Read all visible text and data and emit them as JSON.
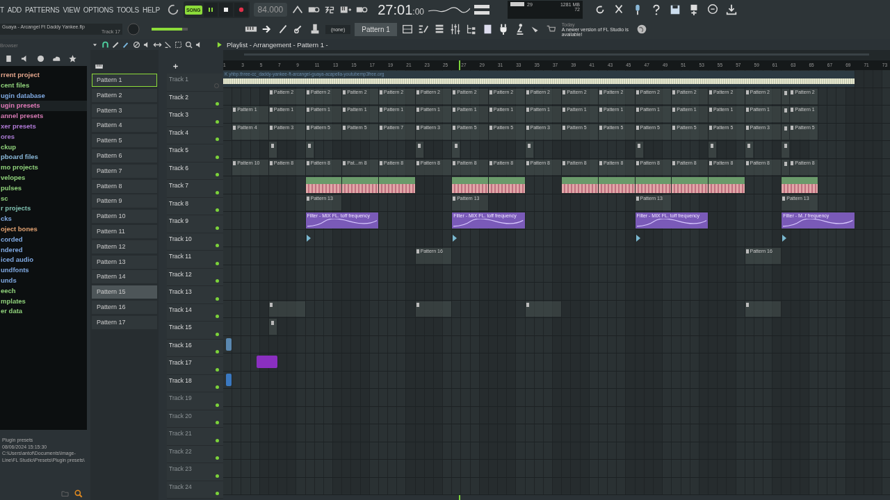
{
  "menu": [
    "T",
    "ADD",
    "PATTERNS",
    "VIEW",
    "OPTIONS",
    "TOOLS",
    "HELP"
  ],
  "transport": {
    "mode_label": "SONG",
    "song_mode": true,
    "playing": true,
    "tempo": "84.000",
    "time": "27:01",
    "time_sub": ":00"
  },
  "project": {
    "title": "Guaya - Arcangel Ft Daddy Yankee.flp",
    "hint": "Track 17"
  },
  "master_volume": {
    "level": 0.85
  },
  "monitor": {
    "cpu": "29",
    "memory": "1281 MB",
    "polyphony": "72"
  },
  "snap": {
    "value": "(none)"
  },
  "pattern_selector": {
    "value": "Pattern 1"
  },
  "news": {
    "when": "Today",
    "text": "A newer version of FL Studio is available!"
  },
  "browser": {
    "title": "Browser",
    "items": [
      {
        "label": "rrent project",
        "color": "#e0a38a",
        "selected": false
      },
      {
        "label": "cent files",
        "color": "#8fd07a",
        "selected": false
      },
      {
        "label": "ugin database",
        "color": "#7fa8e0",
        "selected": false
      },
      {
        "label": "ugin presets",
        "color": "#e07ab8",
        "selected": true
      },
      {
        "label": "annel presets",
        "color": "#d67ab4",
        "selected": false
      },
      {
        "label": "xer presets",
        "color": "#b07ad6",
        "selected": false
      },
      {
        "label": "ores",
        "color": "#a87ad0",
        "selected": false
      },
      {
        "label": "ckup",
        "color": "#8fd07a",
        "selected": false
      },
      {
        "label": "pboard files",
        "color": "#8ab8d8",
        "selected": false
      },
      {
        "label": "mo projects",
        "color": "#8fd07a",
        "selected": false
      },
      {
        "label": "velopes",
        "color": "#8fd07a",
        "selected": false
      },
      {
        "label": "pulses",
        "color": "#8fd07a",
        "selected": false
      },
      {
        "label": "sc",
        "color": "#8fd07a",
        "selected": false
      },
      {
        "label": "r projects",
        "color": "#7fc0b0",
        "selected": false
      },
      {
        "label": "cks",
        "color": "#7fa8e0",
        "selected": false
      },
      {
        "label": "oject bones",
        "color": "#e0a070",
        "selected": false
      },
      {
        "label": "corded",
        "color": "#7fa8e0",
        "selected": false
      },
      {
        "label": "ndered",
        "color": "#7fa8e0",
        "selected": false
      },
      {
        "label": "iced audio",
        "color": "#7fa8e0",
        "selected": false
      },
      {
        "label": "undfonts",
        "color": "#7fa8e0",
        "selected": false
      },
      {
        "label": "unds",
        "color": "#7fa8e0",
        "selected": false
      },
      {
        "label": "eech",
        "color": "#8fd07a",
        "selected": false
      },
      {
        "label": "mplates",
        "color": "#8fd07a",
        "selected": false
      },
      {
        "label": "er data",
        "color": "#8fd07a",
        "selected": false
      }
    ],
    "info": [
      "Plugin presets",
      "08/06/2024 15:15:30",
      "C:\\Users\\antof\\Documents\\Image-Line\\FL Studio\\Presets\\Plugin presets\\"
    ]
  },
  "playlist": {
    "title": "Playlist - Arrangement - Pattern 1 -",
    "ruler": [
      "1",
      "3",
      "5",
      "7",
      "9",
      "11",
      "13",
      "15",
      "17",
      "19",
      "21",
      "23",
      "25",
      "27",
      "29",
      "31",
      "33",
      "35",
      "37",
      "39",
      "41",
      "43",
      "45",
      "47",
      "49",
      "51",
      "53",
      "55",
      "57",
      "59",
      "61",
      "63",
      "65",
      "67",
      "69",
      "71",
      "73"
    ],
    "playhead": {
      "level": 0.353
    },
    "patterns": [
      {
        "label": "Pattern 1",
        "selected": true,
        "hover": false
      },
      {
        "label": "Pattern 2",
        "selected": false,
        "hover": false
      },
      {
        "label": "Pattern 3",
        "selected": false,
        "hover": false
      },
      {
        "label": "Pattern 4",
        "selected": false,
        "hover": false
      },
      {
        "label": "Pattern 5",
        "selected": false,
        "hover": false
      },
      {
        "label": "Pattern 6",
        "selected": false,
        "hover": false
      },
      {
        "label": "Pattern 7",
        "selected": false,
        "hover": false
      },
      {
        "label": "Pattern 8",
        "selected": false,
        "hover": false
      },
      {
        "label": "Pattern 9",
        "selected": false,
        "hover": false
      },
      {
        "label": "Pattern 10",
        "selected": false,
        "hover": false
      },
      {
        "label": "Pattern 11",
        "selected": false,
        "hover": false
      },
      {
        "label": "Pattern 12",
        "selected": false,
        "hover": false
      },
      {
        "label": "Pattern 13",
        "selected": false,
        "hover": false
      },
      {
        "label": "Pattern 14",
        "selected": false,
        "hover": false
      },
      {
        "label": "Pattern 15",
        "selected": false,
        "hover": true
      },
      {
        "label": "Pattern 16",
        "selected": false,
        "hover": false
      },
      {
        "label": "Pattern 17",
        "selected": false,
        "hover": false
      }
    ],
    "tracks": [
      {
        "name": "Track 1",
        "dim": true,
        "led_on": false,
        "clips": [
          {
            "kind": "audio",
            "label": "K yhbp.three-cc_daddy-yankee-ft-arcangel-guaya-acapella-youtubemp3free.org"
          }
        ]
      },
      {
        "name": "Track 2",
        "dim": false,
        "led_on": true,
        "clips": [
          {
            "kind": "empty"
          },
          {
            "kind": "empty"
          },
          {
            "kind": "pattern",
            "label": "Pattern 2"
          },
          {
            "kind": "pattern",
            "label": "Pattern 2"
          },
          {
            "kind": "pattern",
            "label": "Pattern 2"
          },
          {
            "kind": "pattern",
            "label": "Pattern 2"
          },
          {
            "kind": "pattern",
            "label": "Pattern 2"
          },
          {
            "kind": "pattern",
            "label": "Pattern 2"
          },
          {
            "kind": "pattern",
            "label": "Pattern 2"
          },
          {
            "kind": "pattern",
            "label": "Pattern 2"
          },
          {
            "kind": "pattern",
            "label": "Pattern 2"
          },
          {
            "kind": "pattern",
            "label": "Pattern 2"
          },
          {
            "kind": "pattern",
            "label": "Pattern 2"
          },
          {
            "kind": "pattern",
            "label": "Pattern 2"
          },
          {
            "kind": "pattern",
            "label": "Pattern 2"
          },
          {
            "kind": "pattern",
            "label": "Pattern 2"
          },
          {
            "kind": "pattern-late",
            "label": "Pattern 2"
          }
        ]
      },
      {
        "name": "Track 3",
        "dim": false,
        "led_on": true,
        "clips": [
          {
            "kind": "empty"
          },
          {
            "kind": "pattern",
            "label": "Pattern 1"
          },
          {
            "kind": "pattern",
            "label": "Pattern 1"
          },
          {
            "kind": "pattern",
            "label": "Pattern 1"
          },
          {
            "kind": "pattern",
            "label": "Pattern 1"
          },
          {
            "kind": "pattern",
            "label": "Pattern 1"
          },
          {
            "kind": "pattern",
            "label": "Pattern 1"
          },
          {
            "kind": "pattern",
            "label": "Pattern 1"
          },
          {
            "kind": "pattern",
            "label": "Pattern 1"
          },
          {
            "kind": "pattern",
            "label": "Pattern 1"
          },
          {
            "kind": "pattern",
            "label": "Pattern 1"
          },
          {
            "kind": "pattern",
            "label": "Pattern 1"
          },
          {
            "kind": "pattern",
            "label": "Pattern 1"
          },
          {
            "kind": "pattern",
            "label": "Pattern 1"
          },
          {
            "kind": "pattern",
            "label": "Pattern 1"
          },
          {
            "kind": "pattern",
            "label": "Pattern 1"
          },
          {
            "kind": "pattern-late",
            "label": "Pattern 1"
          }
        ]
      },
      {
        "name": "Track 4",
        "dim": false,
        "led_on": true,
        "clips": [
          {
            "kind": "empty"
          },
          {
            "kind": "pattern",
            "label": "Pattern 4"
          },
          {
            "kind": "pattern",
            "label": "Pattern 3"
          },
          {
            "kind": "pattern",
            "label": "Pattern 5"
          },
          {
            "kind": "pattern",
            "label": "Pattern 5"
          },
          {
            "kind": "pattern",
            "label": "Pattern 7"
          },
          {
            "kind": "pattern",
            "label": "Pattern 3"
          },
          {
            "kind": "pattern",
            "label": "Pattern 5"
          },
          {
            "kind": "pattern",
            "label": "Pattern 5"
          },
          {
            "kind": "pattern",
            "label": "Pattern 3"
          },
          {
            "kind": "pattern",
            "label": "Pattern 5"
          },
          {
            "kind": "pattern",
            "label": "Pattern 5"
          },
          {
            "kind": "pattern",
            "label": "Pattern 5"
          },
          {
            "kind": "pattern",
            "label": "Pattern 5"
          },
          {
            "kind": "pattern",
            "label": "Pattern 5"
          },
          {
            "kind": "pattern",
            "label": "Pattern 3"
          },
          {
            "kind": "pattern-late",
            "label": "Pattern 5"
          }
        ]
      },
      {
        "name": "Track 5",
        "dim": false,
        "led_on": true,
        "clips": [
          {
            "kind": "empty"
          },
          {
            "kind": "empty"
          },
          {
            "kind": "stub"
          },
          {
            "kind": "stub"
          },
          {
            "kind": "empty"
          },
          {
            "kind": "empty"
          },
          {
            "kind": "stub"
          },
          {
            "kind": "stub"
          },
          {
            "kind": "empty"
          },
          {
            "kind": "stub"
          },
          {
            "kind": "empty"
          },
          {
            "kind": "empty"
          },
          {
            "kind": "stub"
          },
          {
            "kind": "empty"
          },
          {
            "kind": "stub"
          },
          {
            "kind": "stub"
          },
          {
            "kind": "stub"
          }
        ]
      },
      {
        "name": "Track 6",
        "dim": false,
        "led_on": true,
        "clips": [
          {
            "kind": "empty"
          },
          {
            "kind": "pattern",
            "label": "Pattern 10"
          },
          {
            "kind": "pattern",
            "label": "Pattern 8"
          },
          {
            "kind": "pattern",
            "label": "Pattern 8"
          },
          {
            "kind": "pattern",
            "label": "Pat...rn 8"
          },
          {
            "kind": "pattern",
            "label": "Pattern 8"
          },
          {
            "kind": "pattern",
            "label": "Pattern 8"
          },
          {
            "kind": "pattern",
            "label": "Pattern 8"
          },
          {
            "kind": "pattern",
            "label": "Pattern 8"
          },
          {
            "kind": "pattern",
            "label": "Pattern 8"
          },
          {
            "kind": "pattern",
            "label": "Pattern 8"
          },
          {
            "kind": "pattern",
            "label": "Pattern 8"
          },
          {
            "kind": "pattern",
            "label": "Pattern 8"
          },
          {
            "kind": "pattern",
            "label": "Pattern 8"
          },
          {
            "kind": "pattern",
            "label": "Pattern 8"
          },
          {
            "kind": "pattern",
            "label": "Pattern 8"
          },
          {
            "kind": "pattern-late",
            "label": "Pattern 8"
          }
        ]
      },
      {
        "name": "Track 7",
        "dim": false,
        "led_on": true,
        "clips": [
          {
            "kind": "empty"
          },
          {
            "kind": "empty"
          },
          {
            "kind": "empty"
          },
          {
            "kind": "drums"
          },
          {
            "kind": "drums"
          },
          {
            "kind": "drums"
          },
          {
            "kind": "empty"
          },
          {
            "kind": "drums"
          },
          {
            "kind": "drums"
          },
          {
            "kind": "empty"
          },
          {
            "kind": "drums"
          },
          {
            "kind": "drums"
          },
          {
            "kind": "drums"
          },
          {
            "kind": "drums"
          },
          {
            "kind": "drums"
          },
          {
            "kind": "empty"
          },
          {
            "kind": "drums"
          }
        ]
      },
      {
        "name": "Track 8",
        "dim": false,
        "led_on": true,
        "clips": [
          {
            "kind": "empty"
          },
          {
            "kind": "empty"
          },
          {
            "kind": "empty"
          },
          {
            "kind": "pattern",
            "label": "Pattern 13"
          },
          {
            "kind": "empty"
          },
          {
            "kind": "empty"
          },
          {
            "kind": "empty"
          },
          {
            "kind": "pattern",
            "label": "Pattern 13"
          },
          {
            "kind": "empty"
          },
          {
            "kind": "empty"
          },
          {
            "kind": "empty"
          },
          {
            "kind": "empty"
          },
          {
            "kind": "pattern",
            "label": "Pattern 13"
          },
          {
            "kind": "empty"
          },
          {
            "kind": "empty"
          },
          {
            "kind": "empty"
          },
          {
            "kind": "pattern",
            "label": "Pattern 13"
          }
        ]
      },
      {
        "name": "Track 9",
        "dim": false,
        "led_on": true,
        "clips": [
          {
            "kind": "empty"
          },
          {
            "kind": "empty"
          },
          {
            "kind": "empty"
          },
          {
            "kind": "automation",
            "label": "Filter - MIX FL. toff frequency"
          },
          {
            "kind": "empty"
          },
          {
            "kind": "empty"
          },
          {
            "kind": "automation",
            "label": "Filter - MIX FL. toff frequency"
          },
          {
            "kind": "empty"
          },
          {
            "kind": "empty"
          },
          {
            "kind": "empty"
          },
          {
            "kind": "automation",
            "label": "Filter - MIX FL. toff frequency"
          },
          {
            "kind": "empty"
          },
          {
            "kind": "empty"
          },
          {
            "kind": "automation",
            "label": "Filter - M..f frequency"
          }
        ]
      },
      {
        "name": "Track 10",
        "dim": false,
        "led_on": true,
        "clips": [
          {
            "kind": "empty"
          },
          {
            "kind": "empty"
          },
          {
            "kind": "empty"
          },
          {
            "kind": "marker"
          },
          {
            "kind": "empty"
          },
          {
            "kind": "empty"
          },
          {
            "kind": "empty"
          },
          {
            "kind": "marker"
          },
          {
            "kind": "empty"
          },
          {
            "kind": "empty"
          },
          {
            "kind": "empty"
          },
          {
            "kind": "empty"
          },
          {
            "kind": "marker"
          },
          {
            "kind": "empty"
          },
          {
            "kind": "empty"
          },
          {
            "kind": "empty"
          },
          {
            "kind": "marker"
          }
        ]
      },
      {
        "name": "Track 11",
        "dim": false,
        "led_on": true,
        "clips": [
          {
            "kind": "empty"
          },
          {
            "kind": "empty"
          },
          {
            "kind": "empty"
          },
          {
            "kind": "empty"
          },
          {
            "kind": "empty"
          },
          {
            "kind": "empty"
          },
          {
            "kind": "pattern",
            "label": "Pattern 16"
          },
          {
            "kind": "empty"
          },
          {
            "kind": "empty"
          },
          {
            "kind": "empty"
          },
          {
            "kind": "empty"
          },
          {
            "kind": "empty"
          },
          {
            "kind": "empty"
          },
          {
            "kind": "empty"
          },
          {
            "kind": "empty"
          },
          {
            "kind": "pattern",
            "label": "Pattern 16"
          }
        ]
      },
      {
        "name": "Track 12",
        "dim": false,
        "led_on": true
      },
      {
        "name": "Track 13",
        "dim": false,
        "led_on": true
      },
      {
        "name": "Track 14",
        "dim": false,
        "led_on": true,
        "clips": [
          {
            "kind": "empty"
          },
          {
            "kind": "empty"
          },
          {
            "kind": "pattern"
          },
          {
            "kind": "empty"
          },
          {
            "kind": "empty"
          },
          {
            "kind": "empty"
          },
          {
            "kind": "pattern"
          },
          {
            "kind": "empty"
          },
          {
            "kind": "empty"
          },
          {
            "kind": "pattern"
          },
          {
            "kind": "empty"
          },
          {
            "kind": "empty"
          },
          {
            "kind": "empty"
          },
          {
            "kind": "empty"
          },
          {
            "kind": "empty"
          },
          {
            "kind": "pattern"
          }
        ]
      },
      {
        "name": "Track 15",
        "dim": false,
        "led_on": true,
        "clips": [
          {
            "kind": "empty"
          },
          {
            "kind": "empty"
          },
          {
            "kind": "stub"
          }
        ]
      },
      {
        "name": "Track 16",
        "dim": false,
        "led_on": true,
        "clips": [
          {
            "kind": "block",
            "color": "#5a88b0"
          }
        ]
      },
      {
        "name": "Track 17",
        "dim": false,
        "led_on": true,
        "clips": [
          {
            "kind": "empty"
          },
          {
            "kind": "block-wide",
            "color": "#8a2fc0"
          }
        ]
      },
      {
        "name": "Track 18",
        "dim": false,
        "led_on": true,
        "clips": [
          {
            "kind": "block",
            "color": "#3a78c0"
          }
        ]
      },
      {
        "name": "Track 19",
        "dim": true,
        "led_on": true
      },
      {
        "name": "Track 20",
        "dim": true,
        "led_on": true
      },
      {
        "name": "Track 21",
        "dim": true,
        "led_on": true
      },
      {
        "name": "Track 22",
        "dim": true,
        "led_on": true
      },
      {
        "name": "Track 23",
        "dim": true,
        "led_on": true
      },
      {
        "name": "Track 24",
        "dim": true,
        "led_on": true
      }
    ]
  }
}
